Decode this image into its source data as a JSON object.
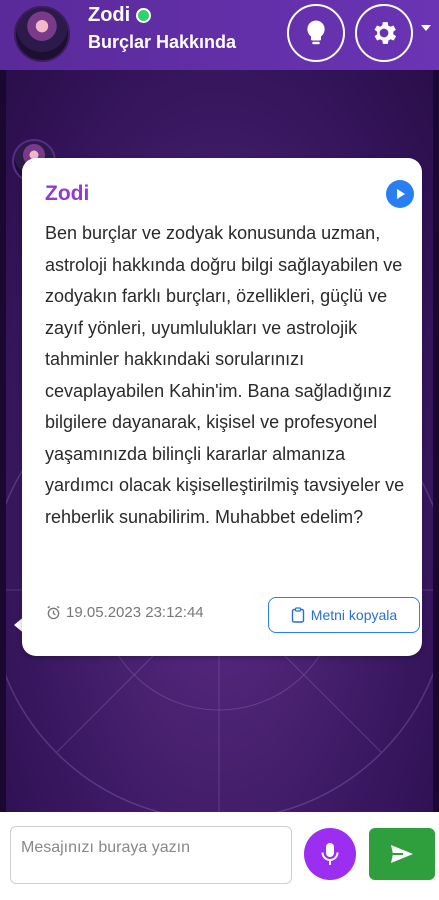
{
  "header": {
    "name": "Zodi",
    "subtitle": "Burçlar Hakkında",
    "online": true,
    "bulb_icon": "lightbulb-icon",
    "gear_icon": "gear-icon"
  },
  "message": {
    "sender": "Zodi",
    "text": "Ben burçlar ve zodyak konusunda uzman, astroloji hakkında doğru bilgi sağlayabilen ve zodyakın farklı burçları, özellikleri, güçlü ve zayıf yönleri, uyumlulukları ve astrolojik tahminler hakkındaki sorularınızı cevaplayabilen Kahin'im. Bana sağladığınız bilgilere dayanarak, kişisel ve profesyonel yaşamınızda bilinçli kararlar almanıza yardımcı olacak kişiselleştirilmiş tavsiyeler ve rehberlik sunabilirim. Muhabbet edelim?",
    "timestamp": "19.05.2023 23:12:44",
    "copy_label": "Metni kopyala"
  },
  "composer": {
    "placeholder": "Mesajınızı buraya yazın"
  },
  "colors": {
    "header": "#6a34b4",
    "sender_name": "#8e3ad6",
    "play": "#2a7ff0",
    "mic": "#9b2ef0",
    "send": "#2f9e3c",
    "online": "#2fd36b"
  }
}
